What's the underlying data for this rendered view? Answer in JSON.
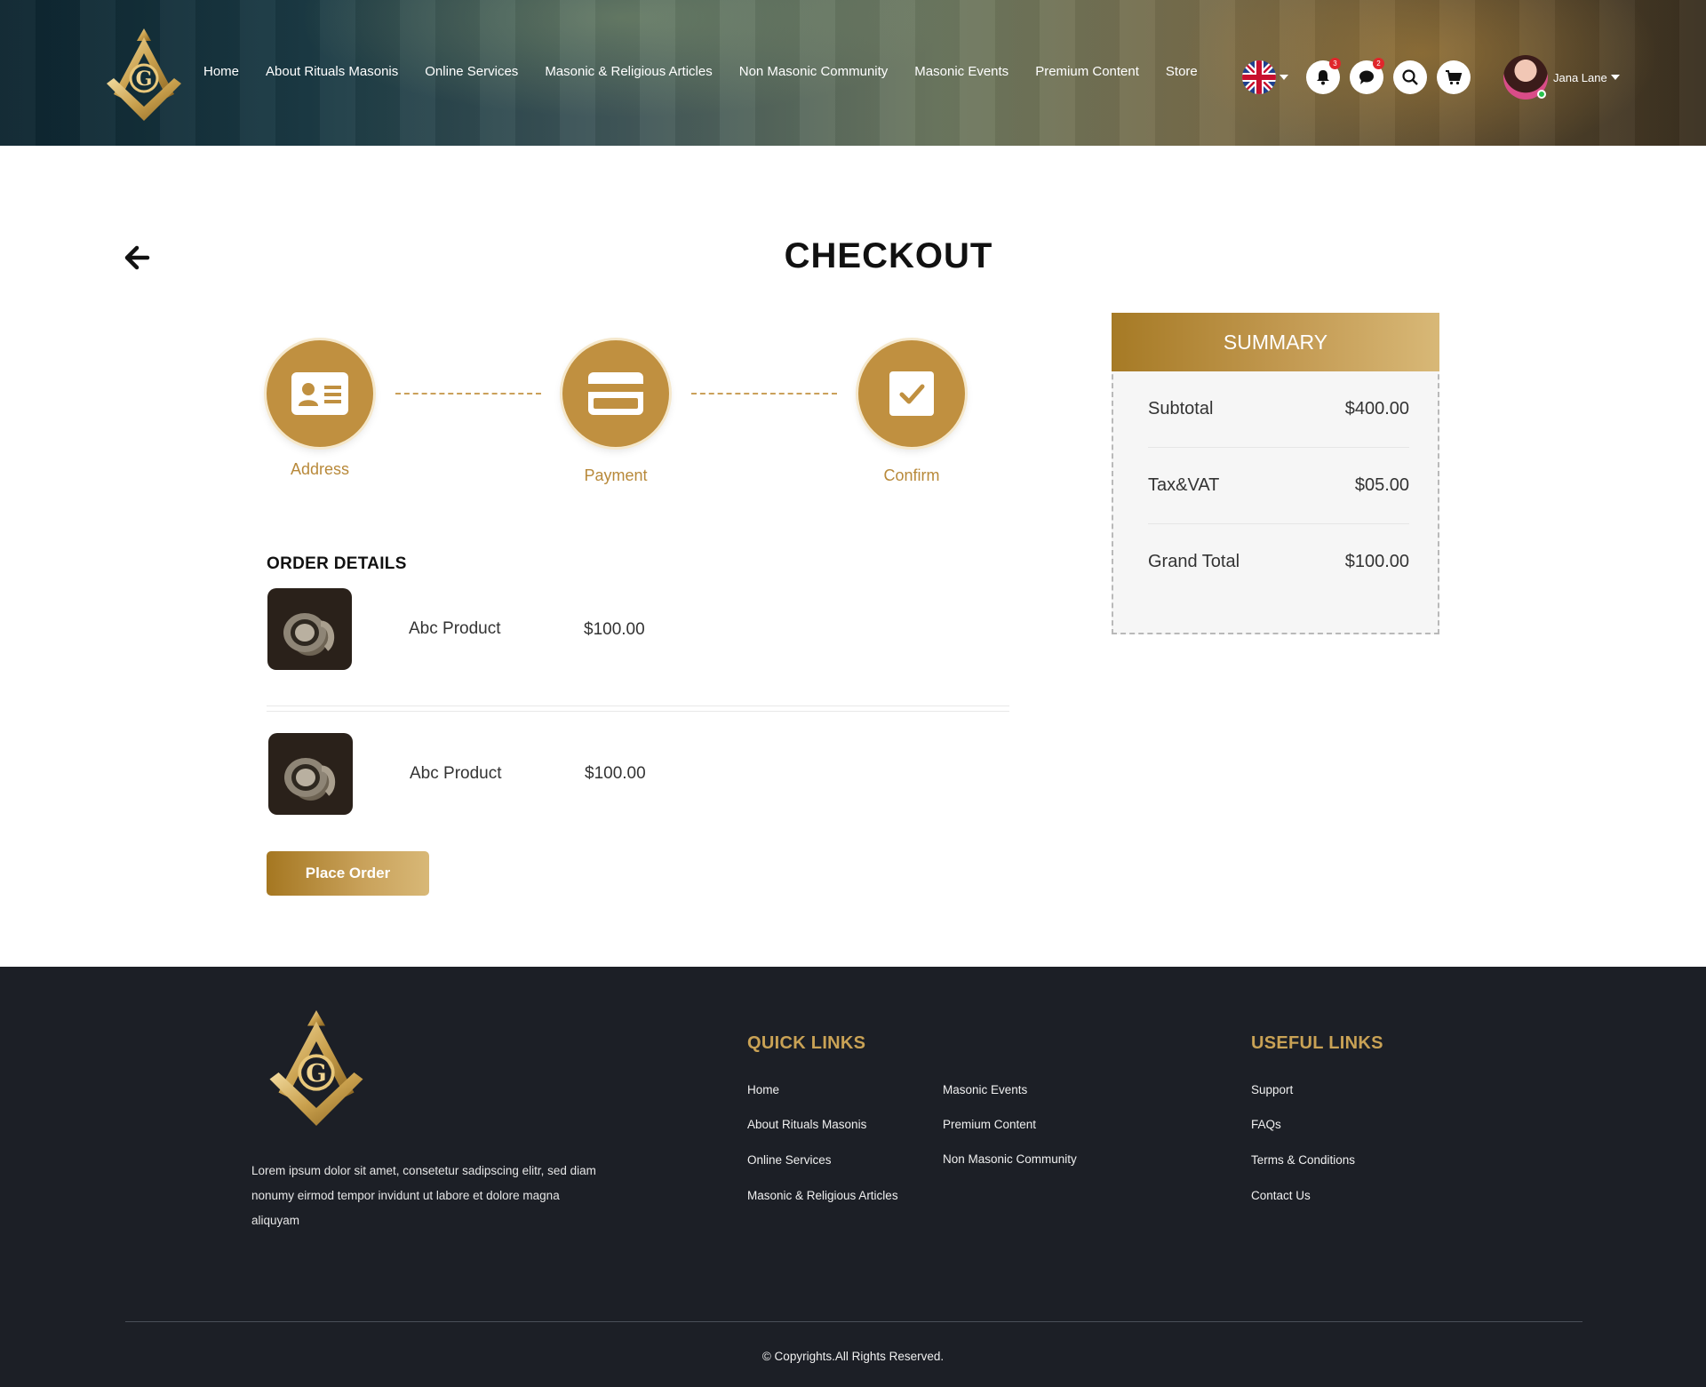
{
  "header": {
    "nav": [
      "Home",
      "About Rituals Masonis",
      "Online Services",
      "Masonic & Religious Articles",
      "Non Masonic Community",
      "Masonic Events",
      "Premium Content",
      "Store"
    ],
    "notifications_count": "3",
    "messages_count": "2",
    "user_name": "Jana Lane",
    "icons": [
      "uk-flag-icon",
      "bell-icon",
      "chat-icon",
      "search-icon",
      "cart-icon"
    ]
  },
  "checkout": {
    "title": "CHECKOUT",
    "steps": [
      "Address",
      "Payment",
      "Confirm"
    ],
    "order_title": "ORDER DETAILS",
    "items": [
      {
        "name": "Abc Product",
        "price": "$100.00"
      },
      {
        "name": "Abc Product",
        "price": "$100.00"
      }
    ],
    "place_order": "Place Order"
  },
  "summary": {
    "title": "SUMMARY",
    "rows": [
      {
        "label": "Subtotal",
        "value": "$400.00"
      },
      {
        "label": "Tax&VAT",
        "value": "$05.00"
      },
      {
        "label": "Grand Total",
        "value": "$100.00"
      }
    ]
  },
  "footer": {
    "about": "Lorem ipsum dolor sit amet, consetetur sadipscing elitr, sed diam nonumy eirmod tempor invidunt ut labore et dolore magna aliquyam",
    "quick_links_title": "QUICK LINKS",
    "quick_links_col1": [
      "Home",
      "About Rituals Masonis",
      "Online Services",
      "Masonic & Religious Articles"
    ],
    "quick_links_col2": [
      "Masonic Events",
      "Premium Content",
      "Non Masonic Community"
    ],
    "useful_links_title": "USEFUL LINKS",
    "useful_links": [
      "Support",
      "FAQs",
      "Terms & Conditions",
      "Contact Us"
    ],
    "copyright": "© Copyrights.All Rights Reserved."
  },
  "colors": {
    "gold": "#c09040",
    "footer_bg": "#1c1f26",
    "footer_heading": "#c9a255"
  }
}
